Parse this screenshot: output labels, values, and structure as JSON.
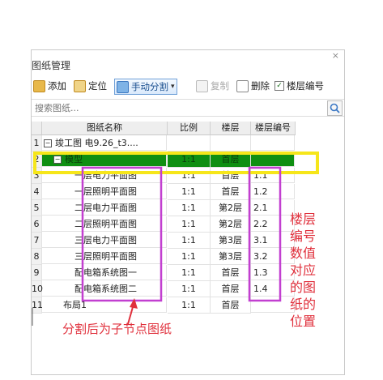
{
  "window": {
    "title": "图纸管理",
    "close_label": "×"
  },
  "toolbar": {
    "add": "添加",
    "locate": "定位",
    "split": "手动分割",
    "split_arrow": "▾",
    "copy": "复制",
    "delete": "删除",
    "floor_code_check": "✓",
    "floor_code": "楼层编号"
  },
  "search": {
    "placeholder": "搜索图纸..."
  },
  "table": {
    "headers": {
      "name": "图纸名称",
      "scale": "比例",
      "floor": "楼层",
      "code": "楼层编号"
    },
    "rows": [
      {
        "num": "1",
        "name": "竣工图   电9.26_t3....",
        "scale": "",
        "floor": "",
        "code": "",
        "expander": "−"
      },
      {
        "num": "2",
        "name": "模型",
        "scale": "1:1",
        "floor": "首层",
        "code": "",
        "expander": "−"
      },
      {
        "num": "3",
        "name": "一层电力平面图",
        "scale": "1:1",
        "floor": "首层",
        "code": "1.1"
      },
      {
        "num": "4",
        "name": "一层照明平面图",
        "scale": "1:1",
        "floor": "首层",
        "code": "1.2"
      },
      {
        "num": "5",
        "name": "二层电力平面图",
        "scale": "1:1",
        "floor": "第2层",
        "code": "2.1"
      },
      {
        "num": "6",
        "name": "二层照明平面图",
        "scale": "1:1",
        "floor": "第2层",
        "code": "2.2"
      },
      {
        "num": "7",
        "name": "三层电力平面图",
        "scale": "1:1",
        "floor": "第3层",
        "code": "3.1"
      },
      {
        "num": "8",
        "name": "三层照明平面图",
        "scale": "1:1",
        "floor": "第3层",
        "code": "3.2"
      },
      {
        "num": "9",
        "name": "配电箱系统图一",
        "scale": "1:1",
        "floor": "首层",
        "code": "1.3"
      },
      {
        "num": "10",
        "name": "配电箱系统图二",
        "scale": "1:1",
        "floor": "首层",
        "code": "1.4"
      },
      {
        "num": "11",
        "name": "布局1",
        "scale": "1:1",
        "floor": "首层",
        "code": ""
      }
    ]
  },
  "annotations": {
    "left_note": "分割后为子节点图纸",
    "right_note": [
      "楼层",
      "编号",
      "数值",
      "对应",
      "的图",
      "纸的",
      "位置"
    ]
  },
  "colors": {
    "highlight_yellow": "#f6e61a",
    "annotation_magenta": "#c23fd0",
    "annotation_red": "#e0303c",
    "selected_green": "#0f8f12"
  }
}
